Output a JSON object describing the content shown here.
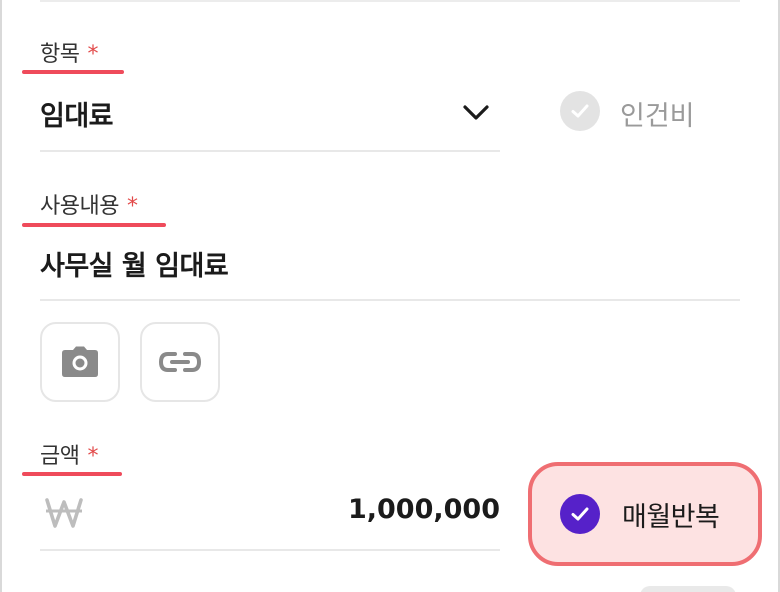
{
  "category": {
    "label": "항목",
    "required_mark": "*",
    "value": "임대료",
    "checkbox_label": "인건비"
  },
  "description": {
    "label": "사용내용",
    "required_mark": "*",
    "value": "사무실 월 임대료"
  },
  "attachments": {
    "camera_icon": "camera-icon",
    "link_icon": "link-icon"
  },
  "amount": {
    "label": "금액",
    "required_mark": "*",
    "currency_icon": "won-icon",
    "value": "1,000,000",
    "repeat_label": "매월반복",
    "repeat_checked": true
  },
  "colors": {
    "required": "#e24a4a",
    "highlight_underline": "#ef4b5b",
    "repeat_bg": "#fde2e2",
    "repeat_border": "#ef6e72",
    "check_purple": "#5621c9"
  }
}
